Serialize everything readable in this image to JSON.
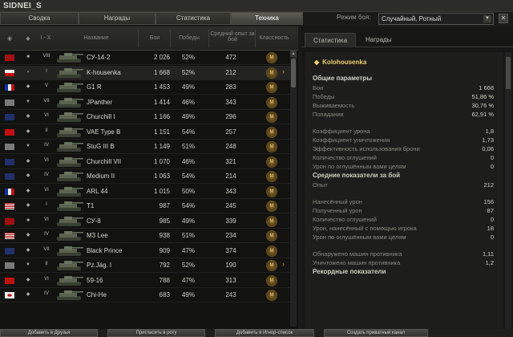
{
  "window": {
    "title": "SIDNEI_S"
  },
  "tabs": [
    "Сводка",
    "Награды",
    "Статистика",
    "Техника"
  ],
  "mode": {
    "label": "Режим боя:",
    "value": "Случайный, Ротный"
  },
  "table": {
    "headers": {
      "tier": "I - X",
      "name": "Название",
      "battles": "Бои",
      "wins": "Победы",
      "xp": "Средний опыт за бой",
      "mastery": "Классность"
    },
    "rows": [
      {
        "nation": "ussr",
        "cls": "■",
        "tier": "VIII",
        "name": "СУ-14-2",
        "battles": "2 026",
        "wins": "52%",
        "xp": "472",
        "chev": ""
      },
      {
        "nation": "cz",
        "cls": "▪",
        "tier": "I",
        "name": "K-housenka",
        "battles": "1 668",
        "wins": "52%",
        "xp": "212",
        "chev": "›"
      },
      {
        "nation": "fr",
        "cls": "◆",
        "tier": "V",
        "name": "G1 R",
        "battles": "1 453",
        "wins": "49%",
        "xp": "283",
        "chev": ""
      },
      {
        "nation": "de",
        "cls": "▼",
        "tier": "VII",
        "name": "JPanther",
        "battles": "1 414",
        "wins": "46%",
        "xp": "343",
        "chev": ""
      },
      {
        "nation": "uk",
        "cls": "◆",
        "tier": "VI",
        "name": "Churchill I",
        "battles": "1 166",
        "wins": "49%",
        "xp": "296",
        "chev": ""
      },
      {
        "nation": "cn",
        "cls": "◆",
        "tier": "II",
        "name": "VAE Type B",
        "battles": "1 151",
        "wins": "54%",
        "xp": "257",
        "chev": ""
      },
      {
        "nation": "de",
        "cls": "▼",
        "tier": "IV",
        "name": "StuG III B",
        "battles": "1 149",
        "wins": "51%",
        "xp": "248",
        "chev": ""
      },
      {
        "nation": "uk",
        "cls": "◆",
        "tier": "VI",
        "name": "Churchill VII",
        "battles": "1 070",
        "wins": "46%",
        "xp": "321",
        "chev": ""
      },
      {
        "nation": "uk",
        "cls": "◆",
        "tier": "IV",
        "name": "Medium II",
        "battles": "1 063",
        "wins": "54%",
        "xp": "214",
        "chev": ""
      },
      {
        "nation": "fr",
        "cls": "◆",
        "tier": "VI",
        "name": "ARL 44",
        "battles": "1 015",
        "wins": "50%",
        "xp": "343",
        "chev": ""
      },
      {
        "nation": "us",
        "cls": "◆",
        "tier": "I",
        "name": "T1",
        "battles": "987",
        "wins": "54%",
        "xp": "245",
        "chev": ""
      },
      {
        "nation": "ussr",
        "cls": "■",
        "tier": "VI",
        "name": "СУ-8",
        "battles": "985",
        "wins": "49%",
        "xp": "339",
        "chev": ""
      },
      {
        "nation": "us",
        "cls": "◆",
        "tier": "IV",
        "name": "M3 Lee",
        "battles": "938",
        "wins": "51%",
        "xp": "234",
        "chev": ""
      },
      {
        "nation": "uk",
        "cls": "◆",
        "tier": "VII",
        "name": "Black Prince",
        "battles": "909",
        "wins": "47%",
        "xp": "374",
        "chev": ""
      },
      {
        "nation": "de",
        "cls": "▼",
        "tier": "II",
        "name": "Pz.Jäg. I",
        "battles": "792",
        "wins": "52%",
        "xp": "190",
        "chev": "›"
      },
      {
        "nation": "cn",
        "cls": "◆",
        "tier": "VI",
        "name": "59-16",
        "battles": "788",
        "wins": "47%",
        "xp": "313",
        "chev": ""
      },
      {
        "nation": "jp",
        "cls": "◆",
        "tier": "IV",
        "name": "Chi-He",
        "battles": "683",
        "wins": "49%",
        "xp": "243",
        "chev": ""
      }
    ]
  },
  "bottom_buttons": [
    "Добавить в Друзья",
    "Пригласить в роту",
    "Добавить в Игнор-список",
    "Создать приватный канал"
  ],
  "right": {
    "tabs": [
      "Статистика",
      "Награды"
    ],
    "tank_name": "Kolohousenka",
    "sections": [
      {
        "title": "Общие параметры",
        "stats": [
          [
            "Бои",
            "1 668"
          ],
          [
            "Победы",
            "51,86 %"
          ],
          [
            "Выживаемость",
            "30,76 %"
          ],
          [
            "Попадания",
            "62,91 %"
          ]
        ]
      },
      {
        "title": "",
        "stats": [
          [
            "Коэффициент урона",
            "1,8"
          ],
          [
            "Коэффициент уничтожения",
            "1,73"
          ],
          [
            "Эффективность использования брони",
            "0,06"
          ],
          [
            "Количество оглушений",
            "0"
          ],
          [
            "Урон по оглушённым вами целям",
            "0"
          ]
        ]
      },
      {
        "title": "Средние показатели за бой",
        "stats": [
          [
            "Опыт",
            "212"
          ]
        ]
      },
      {
        "title": "",
        "stats": [
          [
            "Нанесённый урон",
            "156"
          ],
          [
            "Полученный урон",
            "87"
          ],
          [
            "Количество оглушений",
            "0"
          ],
          [
            "Урон, нанесённый с помощью игрока",
            "18"
          ],
          [
            "Урон по оглушённым вами целям",
            "0"
          ]
        ]
      },
      {
        "title": "",
        "stats": [
          [
            "Обнаружено машин противника",
            "1,11"
          ],
          [
            "Уничтожено машин противника",
            "1,2"
          ]
        ]
      },
      {
        "title": "Рекордные показатели",
        "stats": []
      }
    ]
  },
  "colors": {
    "accent": "#f0d070",
    "bg": "#1a1a18"
  }
}
